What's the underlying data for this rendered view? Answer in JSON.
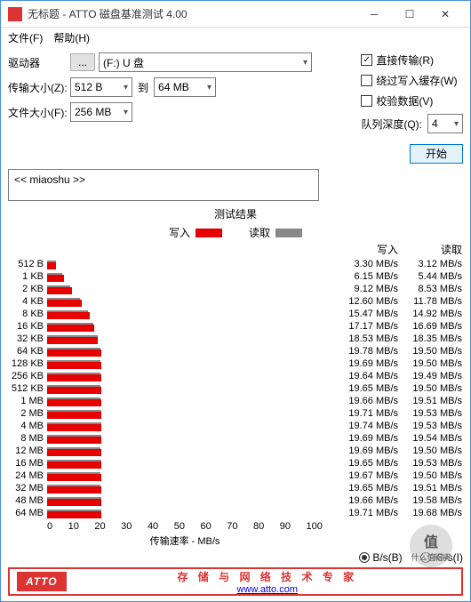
{
  "window": {
    "title": "无标题 - ATTO 磁盘基准测试 4.00"
  },
  "menu": {
    "file": "文件(F)",
    "help": "帮助(H)"
  },
  "labels": {
    "drive": "驱动器",
    "transfer_size": "传输大小(Z):",
    "to": "到",
    "file_size": "文件大小(F):",
    "queue_depth": "队列深度(Q):",
    "direct_io": "直接传输(R)",
    "bypass_cache": "绕过写入缓存(W)",
    "verify": "校验数据(V)",
    "start": "开始",
    "results": "测试结果",
    "write": "写入",
    "read": "读取",
    "xaxis": "传输速率 - MB/s",
    "unit_bs": "B/s(B)",
    "unit_ios": "IO/s(I)"
  },
  "values": {
    "drive": "(F:) U 盘",
    "size_from": "512 B",
    "size_to": "64 MB",
    "file_size": "256 MB",
    "queue_depth": "4",
    "direct_io_checked": true,
    "desc": "<< miaoshu >>"
  },
  "footer": {
    "brand": "ATTO",
    "cn": "存 储 与 网 络 技 术 专 家",
    "url": "www.atto.com"
  },
  "watermark": {
    "line1": "值",
    "line2": "什么值得买"
  },
  "chart_data": {
    "type": "bar",
    "xlabel": "传输速率 - MB/s",
    "xlim": [
      0,
      100
    ],
    "xticks": [
      0,
      10,
      20,
      30,
      40,
      50,
      60,
      70,
      80,
      90,
      100
    ],
    "categories": [
      "512 B",
      "1 KB",
      "2 KB",
      "4 KB",
      "8 KB",
      "16 KB",
      "32 KB",
      "64 KB",
      "128 KB",
      "256 KB",
      "512 KB",
      "1 MB",
      "2 MB",
      "4 MB",
      "8 MB",
      "12 MB",
      "16 MB",
      "24 MB",
      "32 MB",
      "48 MB",
      "64 MB"
    ],
    "series": [
      {
        "name": "写入",
        "values": [
          3.3,
          6.15,
          9.12,
          12.6,
          15.47,
          17.17,
          18.53,
          19.78,
          19.69,
          19.64,
          19.65,
          19.66,
          19.71,
          19.74,
          19.69,
          19.69,
          19.65,
          19.67,
          19.65,
          19.66,
          19.71
        ],
        "unit": "MB/s"
      },
      {
        "name": "读取",
        "values": [
          3.12,
          5.44,
          8.53,
          11.78,
          14.92,
          16.69,
          18.35,
          19.5,
          19.5,
          19.49,
          19.5,
          19.51,
          19.53,
          19.53,
          19.54,
          19.5,
          19.53,
          19.5,
          19.51,
          19.58,
          19.68
        ],
        "unit": "MB/s"
      }
    ]
  }
}
